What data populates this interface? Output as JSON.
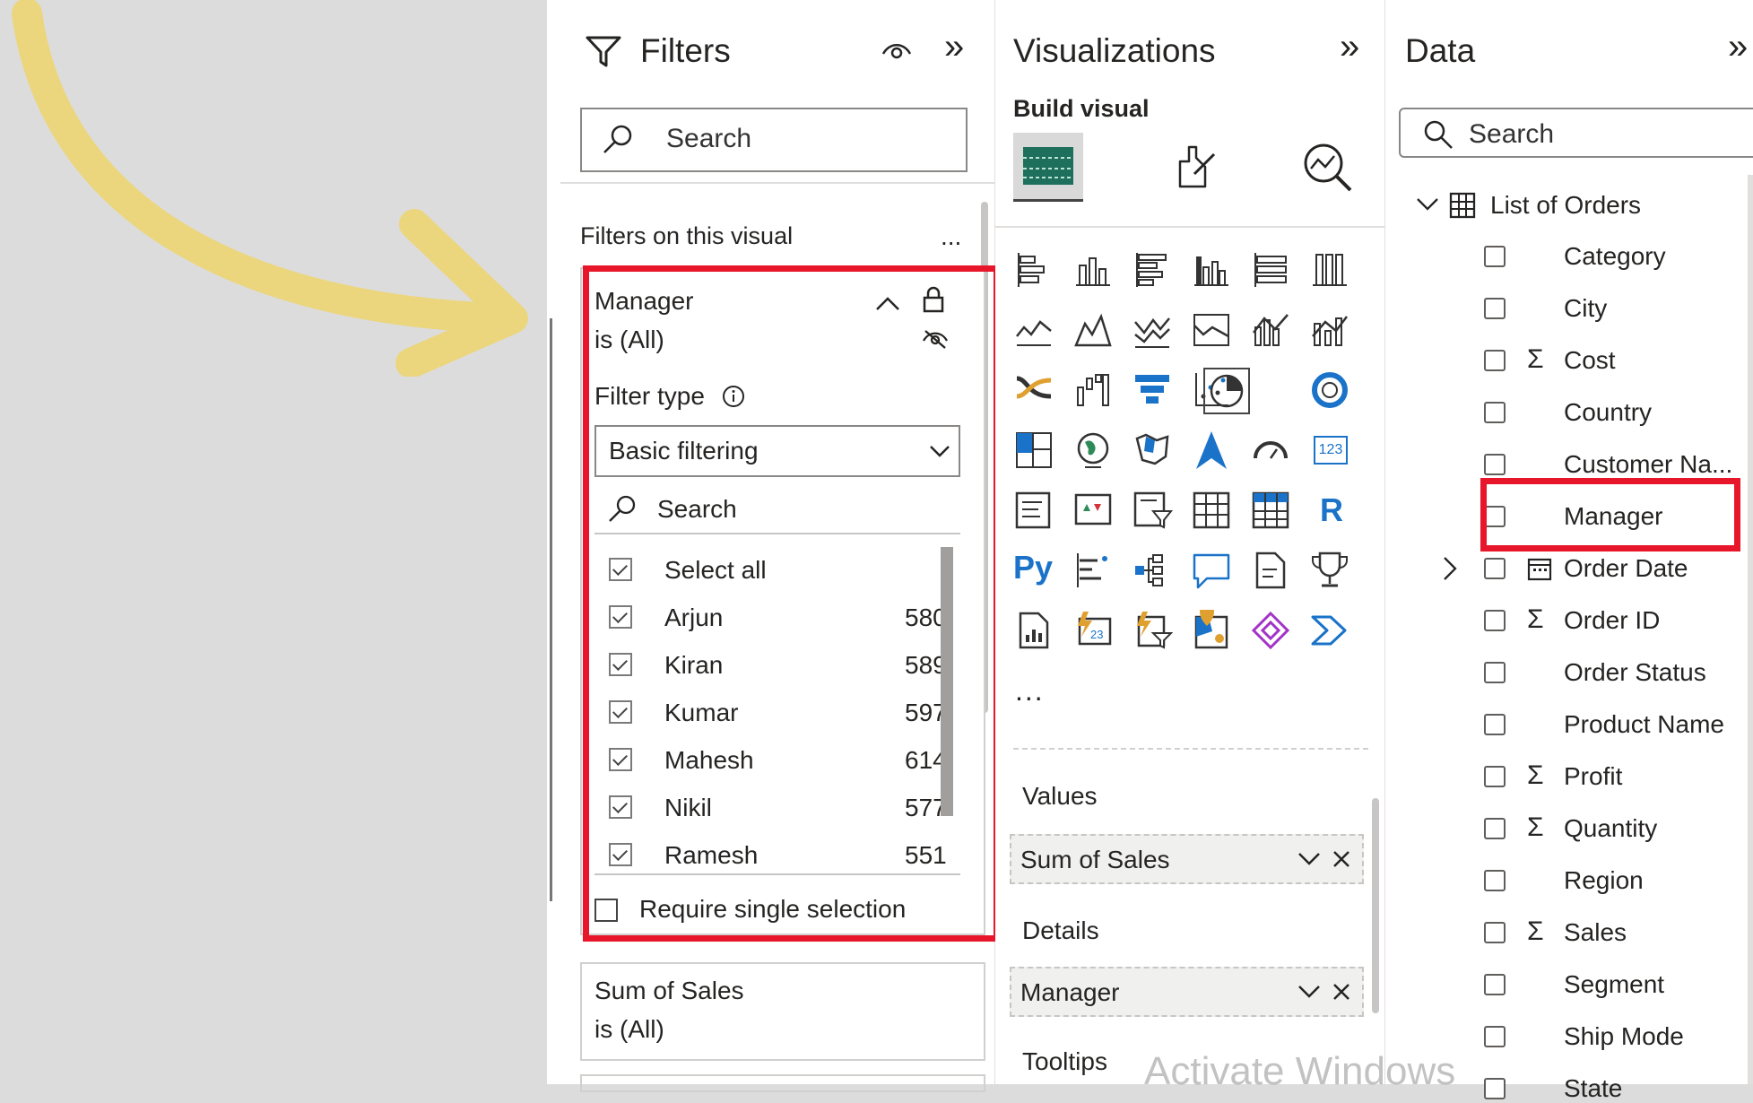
{
  "filters": {
    "title": "Filters",
    "search_placeholder": "Search",
    "section_label": "Filters on this visual",
    "more": "...",
    "manager_card": {
      "field": "Manager",
      "condition": "is (All)",
      "filter_type_label": "Filter type",
      "filter_type_value": "Basic filtering",
      "search_placeholder": "Search",
      "select_all": "Select all",
      "items": [
        {
          "name": "Arjun",
          "count": "580"
        },
        {
          "name": "Kiran",
          "count": "589"
        },
        {
          "name": "Kumar",
          "count": "597"
        },
        {
          "name": "Mahesh",
          "count": "614"
        },
        {
          "name": "Nikil",
          "count": "577"
        },
        {
          "name": "Ramesh",
          "count": "551"
        }
      ],
      "require_single": "Require single selection"
    },
    "sales_card": {
      "field": "Sum of Sales",
      "condition": "is (All)"
    }
  },
  "visualizations": {
    "title": "Visualizations",
    "build_visual": "Build visual",
    "more": "...",
    "values_label": "Values",
    "values_field": "Sum of Sales",
    "details_label": "Details",
    "details_field": "Manager",
    "tooltips_label": "Tooltips",
    "py_label": "Py",
    "r_label": "R",
    "num_label": "123"
  },
  "data": {
    "title": "Data",
    "search_placeholder": "Search",
    "table": "List of Orders",
    "fields": [
      {
        "name": "Category",
        "sigma": false,
        "cal": false
      },
      {
        "name": "City",
        "sigma": false,
        "cal": false
      },
      {
        "name": "Cost",
        "sigma": true,
        "cal": false
      },
      {
        "name": "Country",
        "sigma": false,
        "cal": false
      },
      {
        "name": "Customer Na...",
        "sigma": false,
        "cal": false
      },
      {
        "name": "Manager",
        "sigma": false,
        "cal": false
      },
      {
        "name": "Order Date",
        "sigma": false,
        "cal": true
      },
      {
        "name": "Order ID",
        "sigma": true,
        "cal": false
      },
      {
        "name": "Order Status",
        "sigma": false,
        "cal": false
      },
      {
        "name": "Product Name",
        "sigma": false,
        "cal": false
      },
      {
        "name": "Profit",
        "sigma": true,
        "cal": false
      },
      {
        "name": "Quantity",
        "sigma": true,
        "cal": false
      },
      {
        "name": "Region",
        "sigma": false,
        "cal": false
      },
      {
        "name": "Sales",
        "sigma": true,
        "cal": false
      },
      {
        "name": "Segment",
        "sigma": false,
        "cal": false
      },
      {
        "name": "Ship Mode",
        "sigma": false,
        "cal": false
      },
      {
        "name": "State",
        "sigma": false,
        "cal": false
      }
    ]
  },
  "watermark": "Activate Windows",
  "colors": {
    "highlight": "#e8162b",
    "arrow": "#ebd67e",
    "accent": "#1a73c8"
  }
}
